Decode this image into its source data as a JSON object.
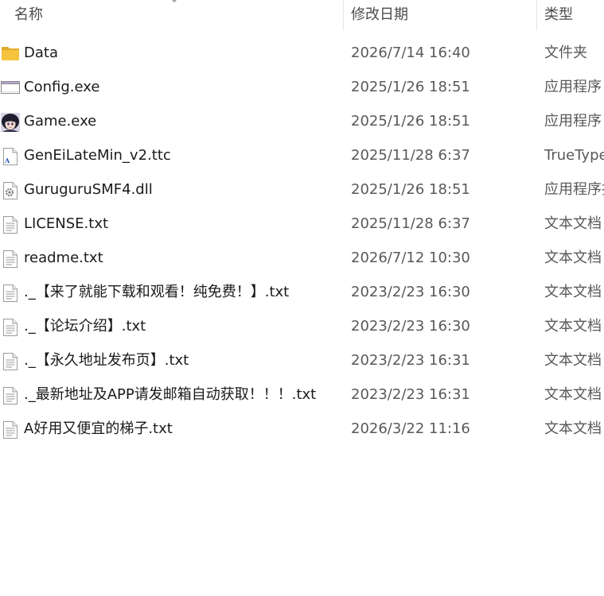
{
  "columns": {
    "name": "名称",
    "date": "修改日期",
    "type": "类型"
  },
  "files": [
    {
      "name": "Data",
      "date": "2026/7/14 16:40",
      "type": "文件夹",
      "icon": "folder-icon"
    },
    {
      "name": "Config.exe",
      "date": "2025/1/26 18:51",
      "type": "应用程序",
      "icon": "window-app-icon"
    },
    {
      "name": "Game.exe",
      "date": "2025/1/26 18:51",
      "type": "应用程序",
      "icon": "anime-character-icon"
    },
    {
      "name": "GenEiLateMin_v2.ttc",
      "date": "2025/11/28 6:37",
      "type": "TrueType",
      "icon": "font-file-icon"
    },
    {
      "name": "GuruguruSMF4.dll",
      "date": "2025/1/26 18:51",
      "type": "应用程序扩",
      "icon": "dll-gear-icon"
    },
    {
      "name": "LICENSE.txt",
      "date": "2025/11/28 6:37",
      "type": "文本文档",
      "icon": "text-file-icon"
    },
    {
      "name": "readme.txt",
      "date": "2026/7/12 10:30",
      "type": "文本文档",
      "icon": "text-file-icon"
    },
    {
      "name": "._【来了就能下载和观看！纯免费！】.txt",
      "date": "2023/2/23 16:30",
      "type": "文本文档",
      "icon": "text-file-icon"
    },
    {
      "name": "._【论坛介绍】.txt",
      "date": "2023/2/23 16:30",
      "type": "文本文档",
      "icon": "text-file-icon"
    },
    {
      "name": "._【永久地址发布页】.txt",
      "date": "2023/2/23 16:31",
      "type": "文本文档",
      "icon": "text-file-icon"
    },
    {
      "name": "._最新地址及APP请发邮箱自动获取！！！.txt",
      "date": "2023/2/23 16:31",
      "type": "文本文档",
      "icon": "text-file-icon"
    },
    {
      "name": "A好用又便宜的梯子.txt",
      "date": "2026/3/22 11:16",
      "type": "文本文档",
      "icon": "text-file-icon"
    }
  ],
  "colors": {
    "folder": "#f6c33f",
    "folder_tab": "#e0a92a",
    "header_text": "#4d4d4d",
    "secondary_text": "#595959"
  }
}
